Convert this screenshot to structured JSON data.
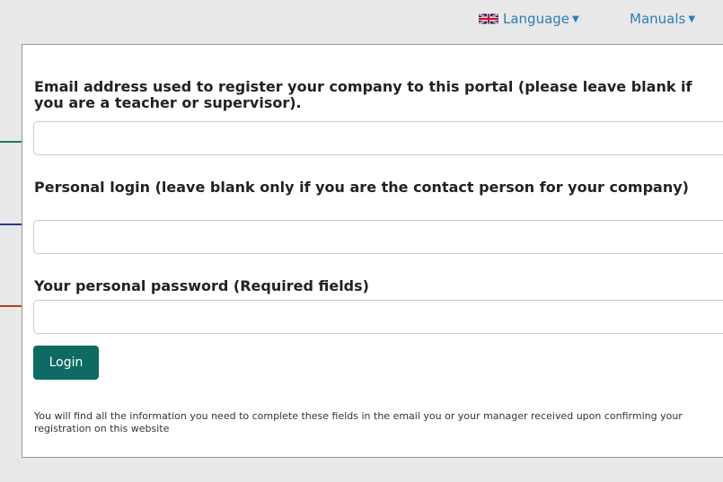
{
  "nav": {
    "language_label": "Language",
    "manuals_label": "Manuals",
    "flag_icon": "uk-flag-icon"
  },
  "form": {
    "email_label": "Email address used to register your company to this portal (please leave blank if you are a teacher or supervisor).",
    "email_value": "",
    "login_label": "Personal login (leave blank only if you are the contact person for your company)",
    "login_value": "",
    "password_label": "Your personal password (Required fields)",
    "password_value": "",
    "submit_label": "Login",
    "note": "You will find all the information you need to complete these fields in the email you or your manager received upon confirming your registration on this website"
  },
  "colors": {
    "accent": "#0e6b63",
    "link": "#2a7fb8",
    "line_email": "#1a7a6a",
    "line_login": "#2b3a8a",
    "line_password": "#c0392b"
  }
}
